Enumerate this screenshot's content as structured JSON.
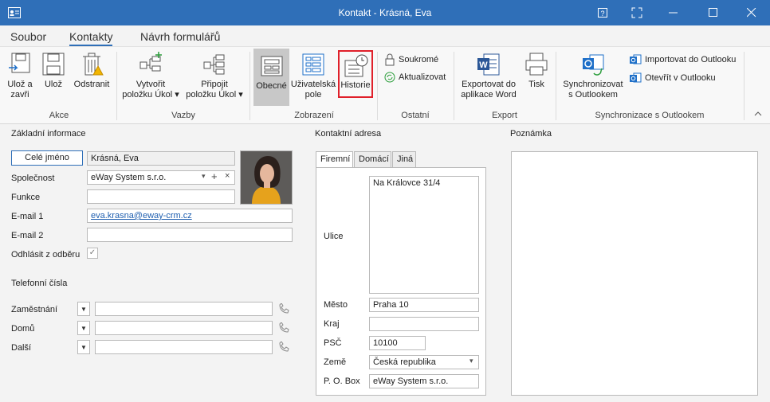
{
  "window": {
    "title": "Kontakt - Krásná, Eva",
    "buttons": [
      "?",
      "⤢",
      "—",
      "☐",
      "✕"
    ]
  },
  "tabs": [
    "Soubor",
    "Kontakty",
    "Návrh formulářů"
  ],
  "ribbon": {
    "groups": {
      "akce": "Akce",
      "vazby": "Vazby",
      "zobrazeni": "Zobrazení",
      "ostatni": "Ostatní",
      "export": "Export",
      "sync": "Synchronizace s Outlookem"
    },
    "buttons": {
      "uloz_zavri_1": "Ulož a",
      "uloz_zavri_2": "zavři",
      "uloz": "Ulož",
      "odstranit": "Odstranit",
      "vytvorit_1": "Vytvořit",
      "vytvorit_2": "položku Úkol ▾",
      "pripojit_1": "Připojit",
      "pripojit_2": "položku Úkol ▾",
      "obecne": "Obecné",
      "uzivatelska_1": "Uživatelská",
      "uzivatelska_2": "pole",
      "historie": "Historie",
      "soukrome": "Soukromé",
      "aktualizovat": "Aktualizovat",
      "export_word_1": "Exportovat do",
      "export_word_2": "aplikace Word",
      "tisk": "Tisk",
      "sync_1": "Synchronizovat",
      "sync_2": "s Outlookem",
      "importovat": "Importovat do Outlooku",
      "otevrit": "Otevřít v Outlooku"
    }
  },
  "basic": {
    "section": "Základní informace",
    "full_name_button": "Celé jméno",
    "full_name_value": "Krásná, Eva",
    "company_label": "Společnost",
    "company_value": "eWay System s.r.o.",
    "function_label": "Funkce",
    "function_value": "",
    "email1_label": "E-mail 1",
    "email1_value": "eva.krasna@eway-crm.cz",
    "email2_label": "E-mail 2",
    "email2_value": "",
    "unsubscribe_label": "Odhlásit z odběru",
    "unsubscribe_checked": "✓"
  },
  "phones": {
    "section": "Telefonní čísla",
    "rows": [
      {
        "label": "Zaměstnání",
        "value": ""
      },
      {
        "label": "Domů",
        "value": ""
      },
      {
        "label": "Další",
        "value": ""
      }
    ]
  },
  "address": {
    "section": "Kontaktní adresa",
    "tabs": [
      "Firemní",
      "Domácí",
      "Jiná"
    ],
    "street_label": "Ulice",
    "street_value": "Na Královce 31/4",
    "city_label": "Město",
    "city_value": "Praha 10",
    "region_label": "Kraj",
    "region_value": "",
    "zip_label": "PSČ",
    "zip_value": "10100",
    "country_label": "Země",
    "country_value": "Česká republika",
    "pobox_label": "P. O. Box",
    "pobox_value": "eWay System s.r.o."
  },
  "note": {
    "section": "Poznámka",
    "value": ""
  },
  "colors": {
    "titlebar": "#2f6fb8",
    "highlight": "#e0202a"
  }
}
